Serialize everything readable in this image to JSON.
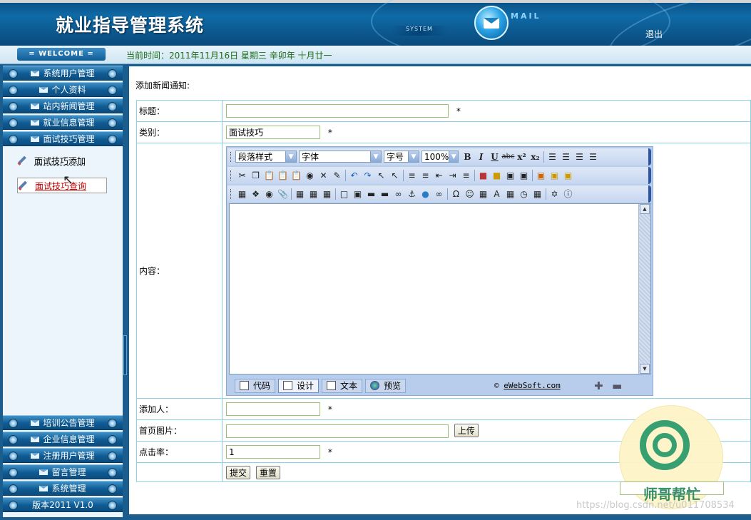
{
  "header": {
    "title": "就业指导管理系统",
    "system_label": "SYSTEM",
    "mail_label": "MAIL",
    "logout": "退出"
  },
  "welcome": {
    "badge": "= WELCOME =",
    "current_time": "当前时间：2011年11月16日 星期三 辛卯年 十月廿一"
  },
  "sidebar": {
    "top_items": [
      {
        "label": "系统用户管理"
      },
      {
        "label": "个人资料"
      },
      {
        "label": "站内新闻管理"
      },
      {
        "label": "就业信息管理"
      },
      {
        "label": "面试技巧管理"
      }
    ],
    "sub_items": [
      {
        "label": "面试技巧添加"
      },
      {
        "label": "面试技巧查询"
      }
    ],
    "bottom_items": [
      {
        "label": "培训公告管理"
      },
      {
        "label": "企业信息管理"
      },
      {
        "label": "注册用户管理"
      },
      {
        "label": "留言管理"
      },
      {
        "label": "系统管理"
      },
      {
        "label": "版本2011 V1.0"
      }
    ]
  },
  "form": {
    "heading": "添加新闻通知:",
    "required_mark": "*",
    "title_label": "标题：",
    "title_value": "",
    "category_label": "类别：",
    "category_value": "面试技巧",
    "content_label": "内容：",
    "adder_label": "添加人：",
    "adder_value": "",
    "image_label": "首页图片：",
    "image_value": "",
    "upload_button": "上传",
    "clicks_label": "点击率：",
    "clicks_value": "1",
    "submit_button": "提交",
    "reset_button": "重置"
  },
  "editor": {
    "paragraph_style": "段落样式",
    "font": "字体",
    "font_size": "字号",
    "zoom": "100%",
    "modes": [
      {
        "label": "代码"
      },
      {
        "label": "设计"
      },
      {
        "label": "文本"
      },
      {
        "label": "预览"
      }
    ],
    "copyright_prefix": "© ",
    "copyright_link": "eWebSoft.com"
  },
  "watermark": {
    "text": "师哥帮忙",
    "url": "https://blog.csdn.net/u011708534"
  }
}
